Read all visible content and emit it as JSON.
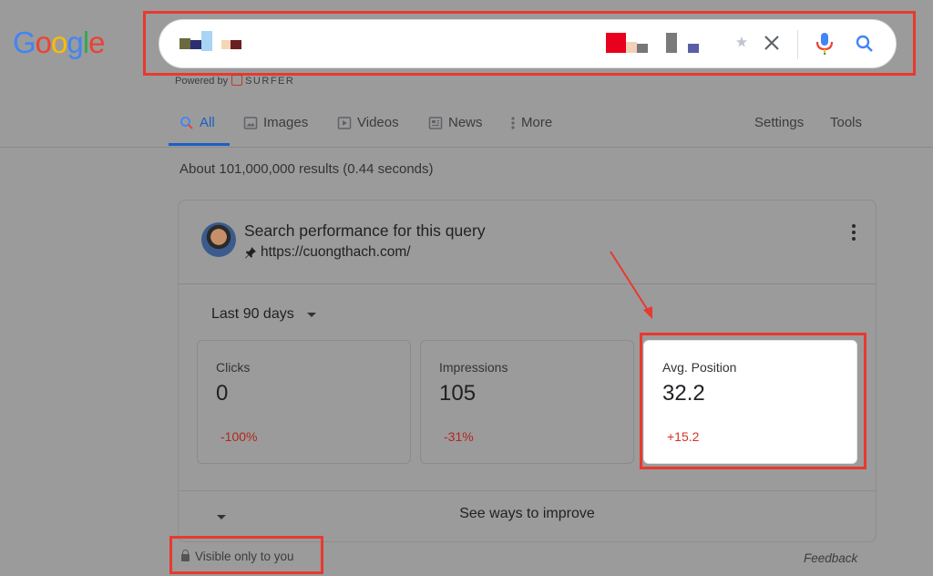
{
  "logo": {
    "letters": [
      "G",
      "o",
      "o",
      "g",
      "l",
      "e"
    ],
    "colors": [
      "#4285f4",
      "#ea4335",
      "#fbbc05",
      "#4285f4",
      "#34a853",
      "#ea4335"
    ]
  },
  "search": {
    "value": ""
  },
  "powered_by": {
    "label": "Powered by",
    "brand": "SURFER"
  },
  "tabs": [
    {
      "label": "All",
      "icon": "search-icon",
      "active": true
    },
    {
      "label": "Images",
      "icon": "image-icon"
    },
    {
      "label": "Videos",
      "icon": "play-icon"
    },
    {
      "label": "News",
      "icon": "news-icon"
    },
    {
      "label": "More",
      "icon": "more-vert-icon"
    }
  ],
  "tools": {
    "settings": "Settings",
    "tools": "Tools"
  },
  "result_stats": "About 101,000,000 results (0.44 seconds)",
  "card": {
    "title": "Search performance for this query",
    "url": "https://cuongthach.com/",
    "period": "Last 90 days",
    "metrics": [
      {
        "label": "Clicks",
        "value": "0",
        "delta": "-100%"
      },
      {
        "label": "Impressions",
        "value": "105",
        "delta": "-31%"
      },
      {
        "label": "Avg. Position",
        "value": "32.2",
        "delta": "+15.2"
      }
    ],
    "improve": "See ways to improve"
  },
  "visible_only": "Visible only to you",
  "feedback": "Feedback",
  "colors": {
    "accent": "#1a5fc4",
    "highlight_red": "#e8392f",
    "delta_red": "#d93025"
  }
}
